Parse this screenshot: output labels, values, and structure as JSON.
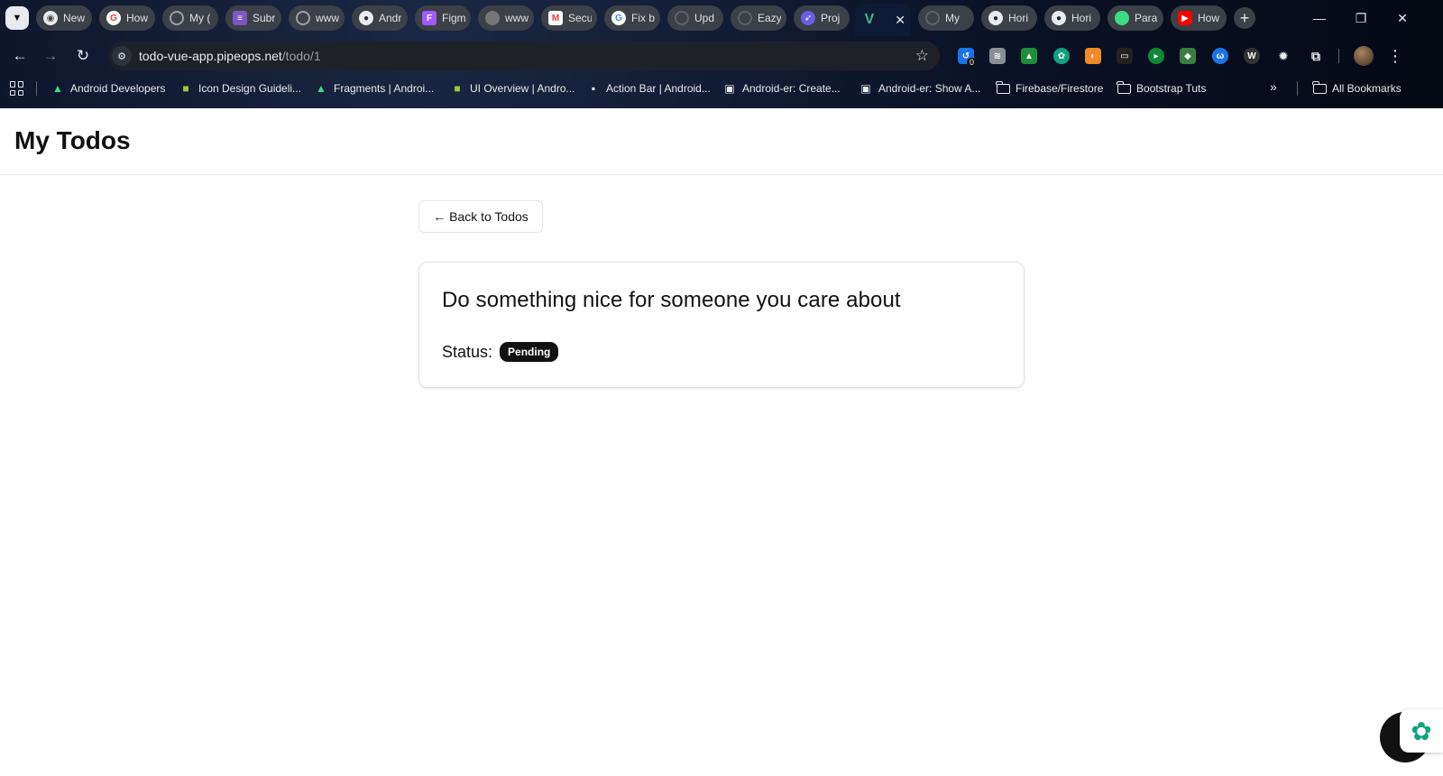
{
  "browser": {
    "tabs": [
      {
        "title": "New",
        "favicon": "chrome-icon",
        "color": "#e8eaed"
      },
      {
        "title": "How",
        "favicon": "google-icon",
        "color": "#ea4335"
      },
      {
        "title": "My (",
        "favicon": "loading-icon",
        "color": "#5f6368"
      },
      {
        "title": "Subr",
        "favicon": "form-icon",
        "color": "#7e57c2"
      },
      {
        "title": "www",
        "favicon": "loading-icon",
        "color": "#5f6368"
      },
      {
        "title": "Andr",
        "favicon": "github-icon",
        "color": "#24292f"
      },
      {
        "title": "Figm",
        "favicon": "figma-icon",
        "color": "#a259ff"
      },
      {
        "title": "www",
        "favicon": "image-icon",
        "color": "#777777"
      },
      {
        "title": "Secu",
        "favicon": "gmail-icon",
        "color": "#ea4335"
      },
      {
        "title": "Fix b",
        "favicon": "google-icon",
        "color": "#4285f4"
      },
      {
        "title": "Upd",
        "favicon": "loading-icon",
        "color": "#5f6368"
      },
      {
        "title": "Eazy",
        "favicon": "loading-icon",
        "color": "#5f6368"
      },
      {
        "title": "Proj",
        "favicon": "rocket-icon",
        "color": "#6c5ce7"
      },
      {
        "title": "",
        "favicon": "vue-icon",
        "color": "#41b883",
        "active": true
      },
      {
        "title": "My",
        "favicon": "loading-icon",
        "color": "#5f6368"
      },
      {
        "title": "Hori",
        "favicon": "github-icon",
        "color": "#24292f"
      },
      {
        "title": "Hori",
        "favicon": "github-icon",
        "color": "#24292f"
      },
      {
        "title": "Para",
        "favicon": "android-icon",
        "color": "#3ddc84"
      },
      {
        "title": "How",
        "favicon": "youtube-icon",
        "color": "#ff0000"
      }
    ],
    "address": {
      "host": "todo-vue-app.pipeops.net",
      "path": "/todo/1"
    },
    "extension_badge": "0",
    "bookmarks": [
      {
        "label": "Android Developers",
        "icon": "android-icon"
      },
      {
        "label": "Icon Design Guideli...",
        "icon": "android-icon"
      },
      {
        "label": "Fragments | Androi...",
        "icon": "android-icon"
      },
      {
        "label": "UI Overview | Andro...",
        "icon": "android-icon"
      },
      {
        "label": "Action Bar | Android...",
        "icon": "page-icon"
      },
      {
        "label": "Android-er: Create...",
        "icon": "blogger-icon"
      },
      {
        "label": "Android-er: Show A...",
        "icon": "blogger-icon"
      },
      {
        "label": "Firebase/Firestore",
        "icon": "folder-icon"
      },
      {
        "label": "Bootstrap Tuts",
        "icon": "folder-icon"
      }
    ],
    "all_bookmarks": "All Bookmarks"
  },
  "app": {
    "title": "My Todos",
    "back_button": "← Back to Todos",
    "todo": {
      "title": "Do something nice for someone you care about",
      "status_label": "Status:",
      "status": "Pending"
    }
  },
  "colors": {
    "chrome_bg": "#0b1226",
    "badge_bg": "#111111",
    "vue_green": "#41b883",
    "chatgpt_green": "#10a37f"
  }
}
